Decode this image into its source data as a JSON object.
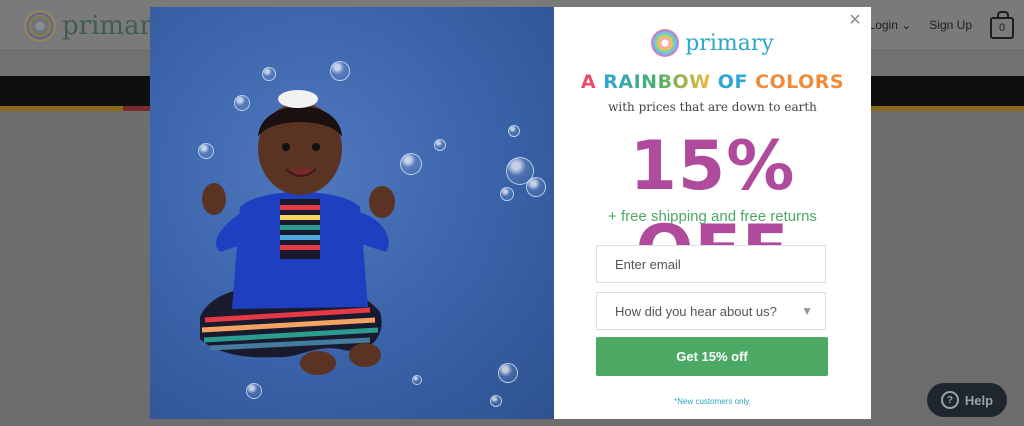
{
  "site": {
    "logo_text": "primary",
    "nav": {
      "login_label": "Login",
      "signup_label": "Sign Up",
      "cart_count": "0"
    },
    "help_label": "Help"
  },
  "modal": {
    "brand_text": "primary",
    "headline": {
      "w1": "A",
      "w2": "RAINBOW",
      "w3": "OF",
      "w4": "COLORS"
    },
    "subhead": "with prices that are down to earth",
    "offer": "15% OFF",
    "shipping": "+ free shipping and free returns",
    "email_placeholder": "Enter email",
    "referral_select": "How did you hear about us?",
    "cta_label": "Get 15% off",
    "fine_print": "*New customers only.",
    "close_label": "×"
  },
  "colors": {
    "offer": "#b04a9c",
    "cta": "#4ca964",
    "brand": "#2aa8c4"
  }
}
